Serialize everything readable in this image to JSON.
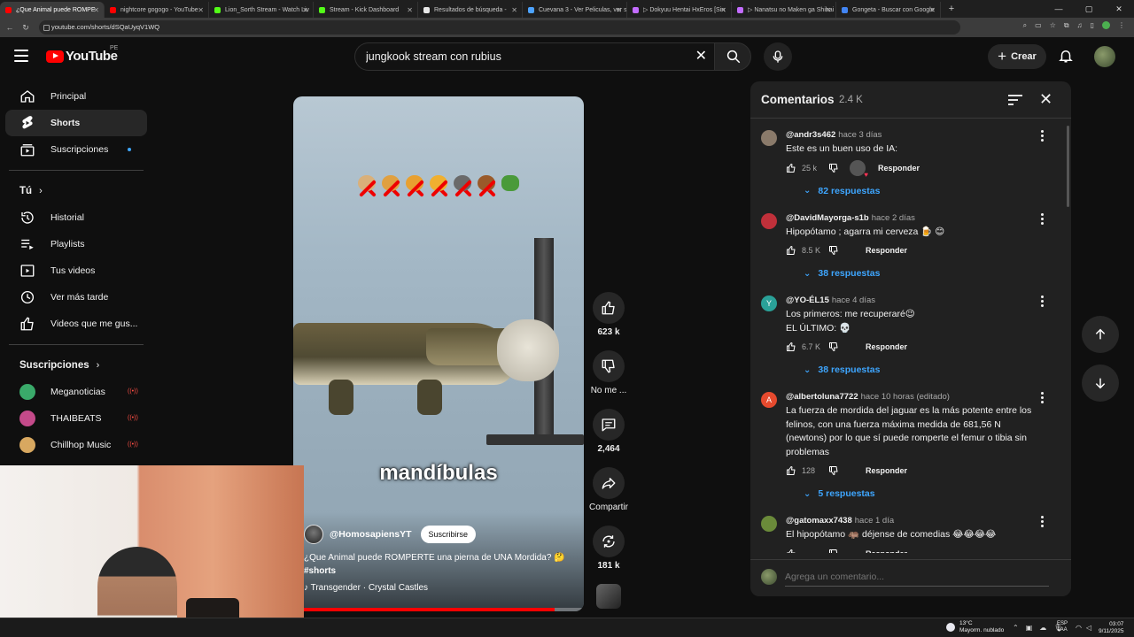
{
  "browser": {
    "tabs": [
      {
        "title": "¿Que Animal puede ROMPE",
        "color": "#ff0000",
        "active": true
      },
      {
        "title": "nightcore gogogo - YouTube",
        "color": "#ff0000",
        "active": false
      },
      {
        "title": "Lion_Sorth Stream - Watch Liv",
        "color": "#53fc18",
        "active": false
      },
      {
        "title": "Stream - Kick Dashboard",
        "color": "#53fc18",
        "active": false
      },
      {
        "title": "Resultados de búsqueda -",
        "color": "#e8e8e8",
        "active": false
      },
      {
        "title": "Cuevana 3 - Ver Peliculas, ver s",
        "color": "#4da3ff",
        "active": false
      },
      {
        "title": "▷ Dokyuu Hentai HxEros [Sin",
        "color": "#c36cff",
        "active": false
      },
      {
        "title": "▷ Nanatsu no Maken ga Shihai",
        "color": "#c36cff",
        "active": false
      },
      {
        "title": "Gongeta - Buscar con Google",
        "color": "#4285f4",
        "active": false
      }
    ],
    "url": "youtube.com/shorts/dSQaUyqV1WQ"
  },
  "header": {
    "logo_text": "YouTube",
    "region": "PE",
    "search_value": "jungkook stream con rubius",
    "create_label": "Crear"
  },
  "sidebar": {
    "items": [
      {
        "label": "Principal",
        "icon": "home-icon",
        "active": false
      },
      {
        "label": "Shorts",
        "icon": "shorts-icon",
        "active": true
      },
      {
        "label": "Suscripciones",
        "icon": "subscriptions-icon",
        "active": false
      }
    ],
    "you_heading": "Tú",
    "you_items": [
      {
        "label": "Historial",
        "icon": "history-icon"
      },
      {
        "label": "Playlists",
        "icon": "playlist-icon"
      },
      {
        "label": "Tus videos",
        "icon": "your-videos-icon"
      },
      {
        "label": "Ver más tarde",
        "icon": "watch-later-icon"
      },
      {
        "label": "Videos que me gus...",
        "icon": "like-icon"
      }
    ],
    "subs_heading": "Suscripciones",
    "subs": [
      {
        "label": "Meganoticias",
        "color": "#3aaa6a"
      },
      {
        "label": "THAIBEATS",
        "color": "#c44a8a"
      },
      {
        "label": "Chillhop Music",
        "color": "#d8a860"
      }
    ]
  },
  "video": {
    "caption": "mandíbulas",
    "channel": "@HomosapiensYT",
    "subscribe_label": "Suscribirse",
    "title": "¿Que Animal puede ROMPERTE una pierna de UNA Mordida? 🤔",
    "hashtag": "#shorts",
    "music": "Transgender · Crystal Castles",
    "progress": 0.9
  },
  "actions": {
    "likes": "623 k",
    "dislike_label": "No me ...",
    "comments": "2,464",
    "share_label": "Compartir",
    "remix": "181 k"
  },
  "comments_panel": {
    "title": "Comentarios",
    "count": "2.4 K",
    "add_placeholder": "Agrega un comentario...",
    "reply_label": "Responder",
    "items": [
      {
        "user": "@andr3s462",
        "time": "hace 3 días",
        "text": "Este es un buen uso de IA:",
        "likes": "25 k",
        "replies": "82 respuestas",
        "avatar_color": "#8a7a6a",
        "initial": "",
        "heart": true
      },
      {
        "user": "@DavidMayorga-s1b",
        "time": "hace 2 días",
        "text": "Hipopótamo ; agarra mi cerveza 🍺 😊",
        "likes": "8.5 K",
        "replies": "38 respuestas",
        "avatar_color": "#c0303a",
        "initial": "",
        "heart": false
      },
      {
        "user": "@YO-ÉL15",
        "time": "hace 4 días",
        "text": "Los primeros: me recuperaré😉\nEL ÚLTIMO: 💀",
        "likes": "6.7 K",
        "replies": "38 respuestas",
        "avatar_color": "#2aa198",
        "initial": "Y",
        "heart": false
      },
      {
        "user": "@albertoluna7722",
        "time": "hace 10 horas (editado)",
        "text": "La fuerza de mordida del jaguar es la más potente entre los felinos, con una fuerza máxima medida de 681,56 N (newtons) por lo que sí puede romperte el femur o tibia sin problemas",
        "likes": "128",
        "replies": "5 respuestas",
        "avatar_color": "#e64a2e",
        "initial": "A",
        "heart": false
      },
      {
        "user": "@gatomaxx7438",
        "time": "hace 1 día",
        "text": "El hipopótamo 🦛 déjense de comedias 😂😂😂😂",
        "likes": "",
        "replies": "",
        "avatar_color": "#6a8a3a",
        "initial": "",
        "heart": false
      }
    ]
  },
  "taskbar": {
    "temp": "13°C",
    "weather": "Mayorm. nublado",
    "lang1": "ESP",
    "lang2": "LAA",
    "time": "03:07",
    "date": "9/11/2025"
  }
}
